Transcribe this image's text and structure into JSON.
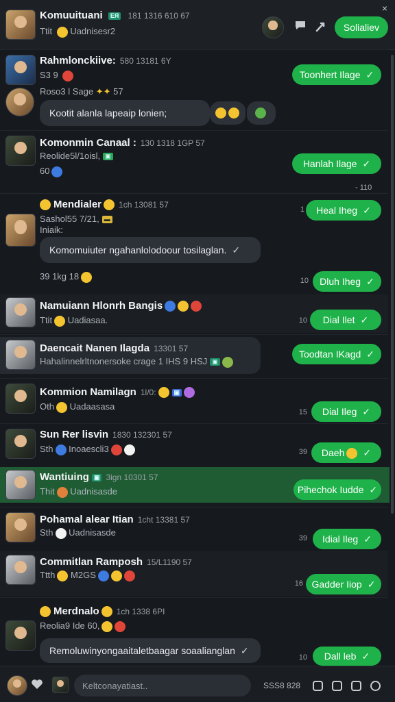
{
  "header": {
    "title": "Komuuituani",
    "badge": "ЕЯ",
    "time": "181 1316 610 67",
    "subtitle": "Ttit",
    "subtitle_extra": "Uadnisesr2",
    "button_label": "Solialiev",
    "close": "×"
  },
  "rows": [
    {
      "name": "Rahmlonckiive:",
      "time": "580 13181 6Y",
      "line2": "S3 9 ",
      "line3": "Roso3 l Sage",
      "line3b": "57",
      "bubble": "Kootit alanla lapeaip lonien;",
      "green": "Toonhert Ilage",
      "side": ""
    },
    {
      "name": "Komonmin Canaal :",
      "time": "130 1318 1GP 57",
      "line2": "Reolide5l/1oisl,",
      "line3": "60",
      "green": "Hanlah Ilage",
      "side": "- 110"
    },
    {
      "name": "Mendialer",
      "time": "1ch 13081 57",
      "line2": "Sashol55 7/21,",
      "line3": "Iniaik:",
      "bubble": "Komomuiuter ngahanlolodoour tosilaglan.",
      "line4": "39 1kg 18",
      "green": "Heal Iheg",
      "green2": "Dluh Iheg",
      "side": "1",
      "side2": "10"
    },
    {
      "name": "Namuiann Hlonrh Bangis",
      "line2": "Ttit",
      "line2b": "Uadiasaa.",
      "green": "Dial Ilet",
      "side": "10"
    },
    {
      "name": "Daencait Nanen Ilagda",
      "time": "13301 57",
      "line2": "Hahalinnelrltnonersoke crage 1 IHS",
      "line2b": "9 HSJ",
      "green": "Toodtan IKagd",
      "side": ""
    },
    {
      "name": "Kommion Namilagn",
      "time": "1l/0:",
      "line2": "Oth",
      "line2b": "Uadaasasa",
      "green": "Dial Ileg",
      "side": "15"
    },
    {
      "name": "Sun Rer lisvin",
      "time": "1830 132301 57",
      "line2": "Sth",
      "line2b": "Inoaescli3",
      "green": "Daeh",
      "side": "39"
    },
    {
      "name": "Wantiuing",
      "time": "3ign 10301 57",
      "line2": "Thit",
      "line2b": "Uadnisasde",
      "green": "Pihechok Iudde",
      "side": ""
    },
    {
      "name": "Pohamal alear Itian",
      "time": "1cht 13381 57",
      "line2": "Sth",
      "line2b": "Uadnisasde",
      "green": "Idial Ileg",
      "side": "39"
    },
    {
      "name": "Commitlan Ramposh",
      "time": "15/L1190 57",
      "line2": "Ttth",
      "line2b": "M2GS",
      "green": "Gadder Iiop",
      "side": "16"
    },
    {
      "name": "Merdnalo",
      "time": "1ch 1338 6PI",
      "line2": "Reolia9",
      "line2b": "Ide 60,",
      "bubble": "Remoluwinyongaaitaletbaagar soaalianglan",
      "green": "Dall leb",
      "side": "10"
    }
  ],
  "footer": {
    "placeholder": "Keltconayatiast..",
    "counter": "SSS8 828"
  },
  "icons": {
    "header": [
      "chat-icon",
      "share-icon",
      "close-icon"
    ],
    "footer": [
      "heart-icon",
      "copy-icon",
      "image-icon",
      "tag-icon",
      "settings-icon"
    ]
  },
  "colors": {
    "accent": "#1fb24a",
    "highlight": "#1f5c34",
    "background": "#16191e"
  }
}
